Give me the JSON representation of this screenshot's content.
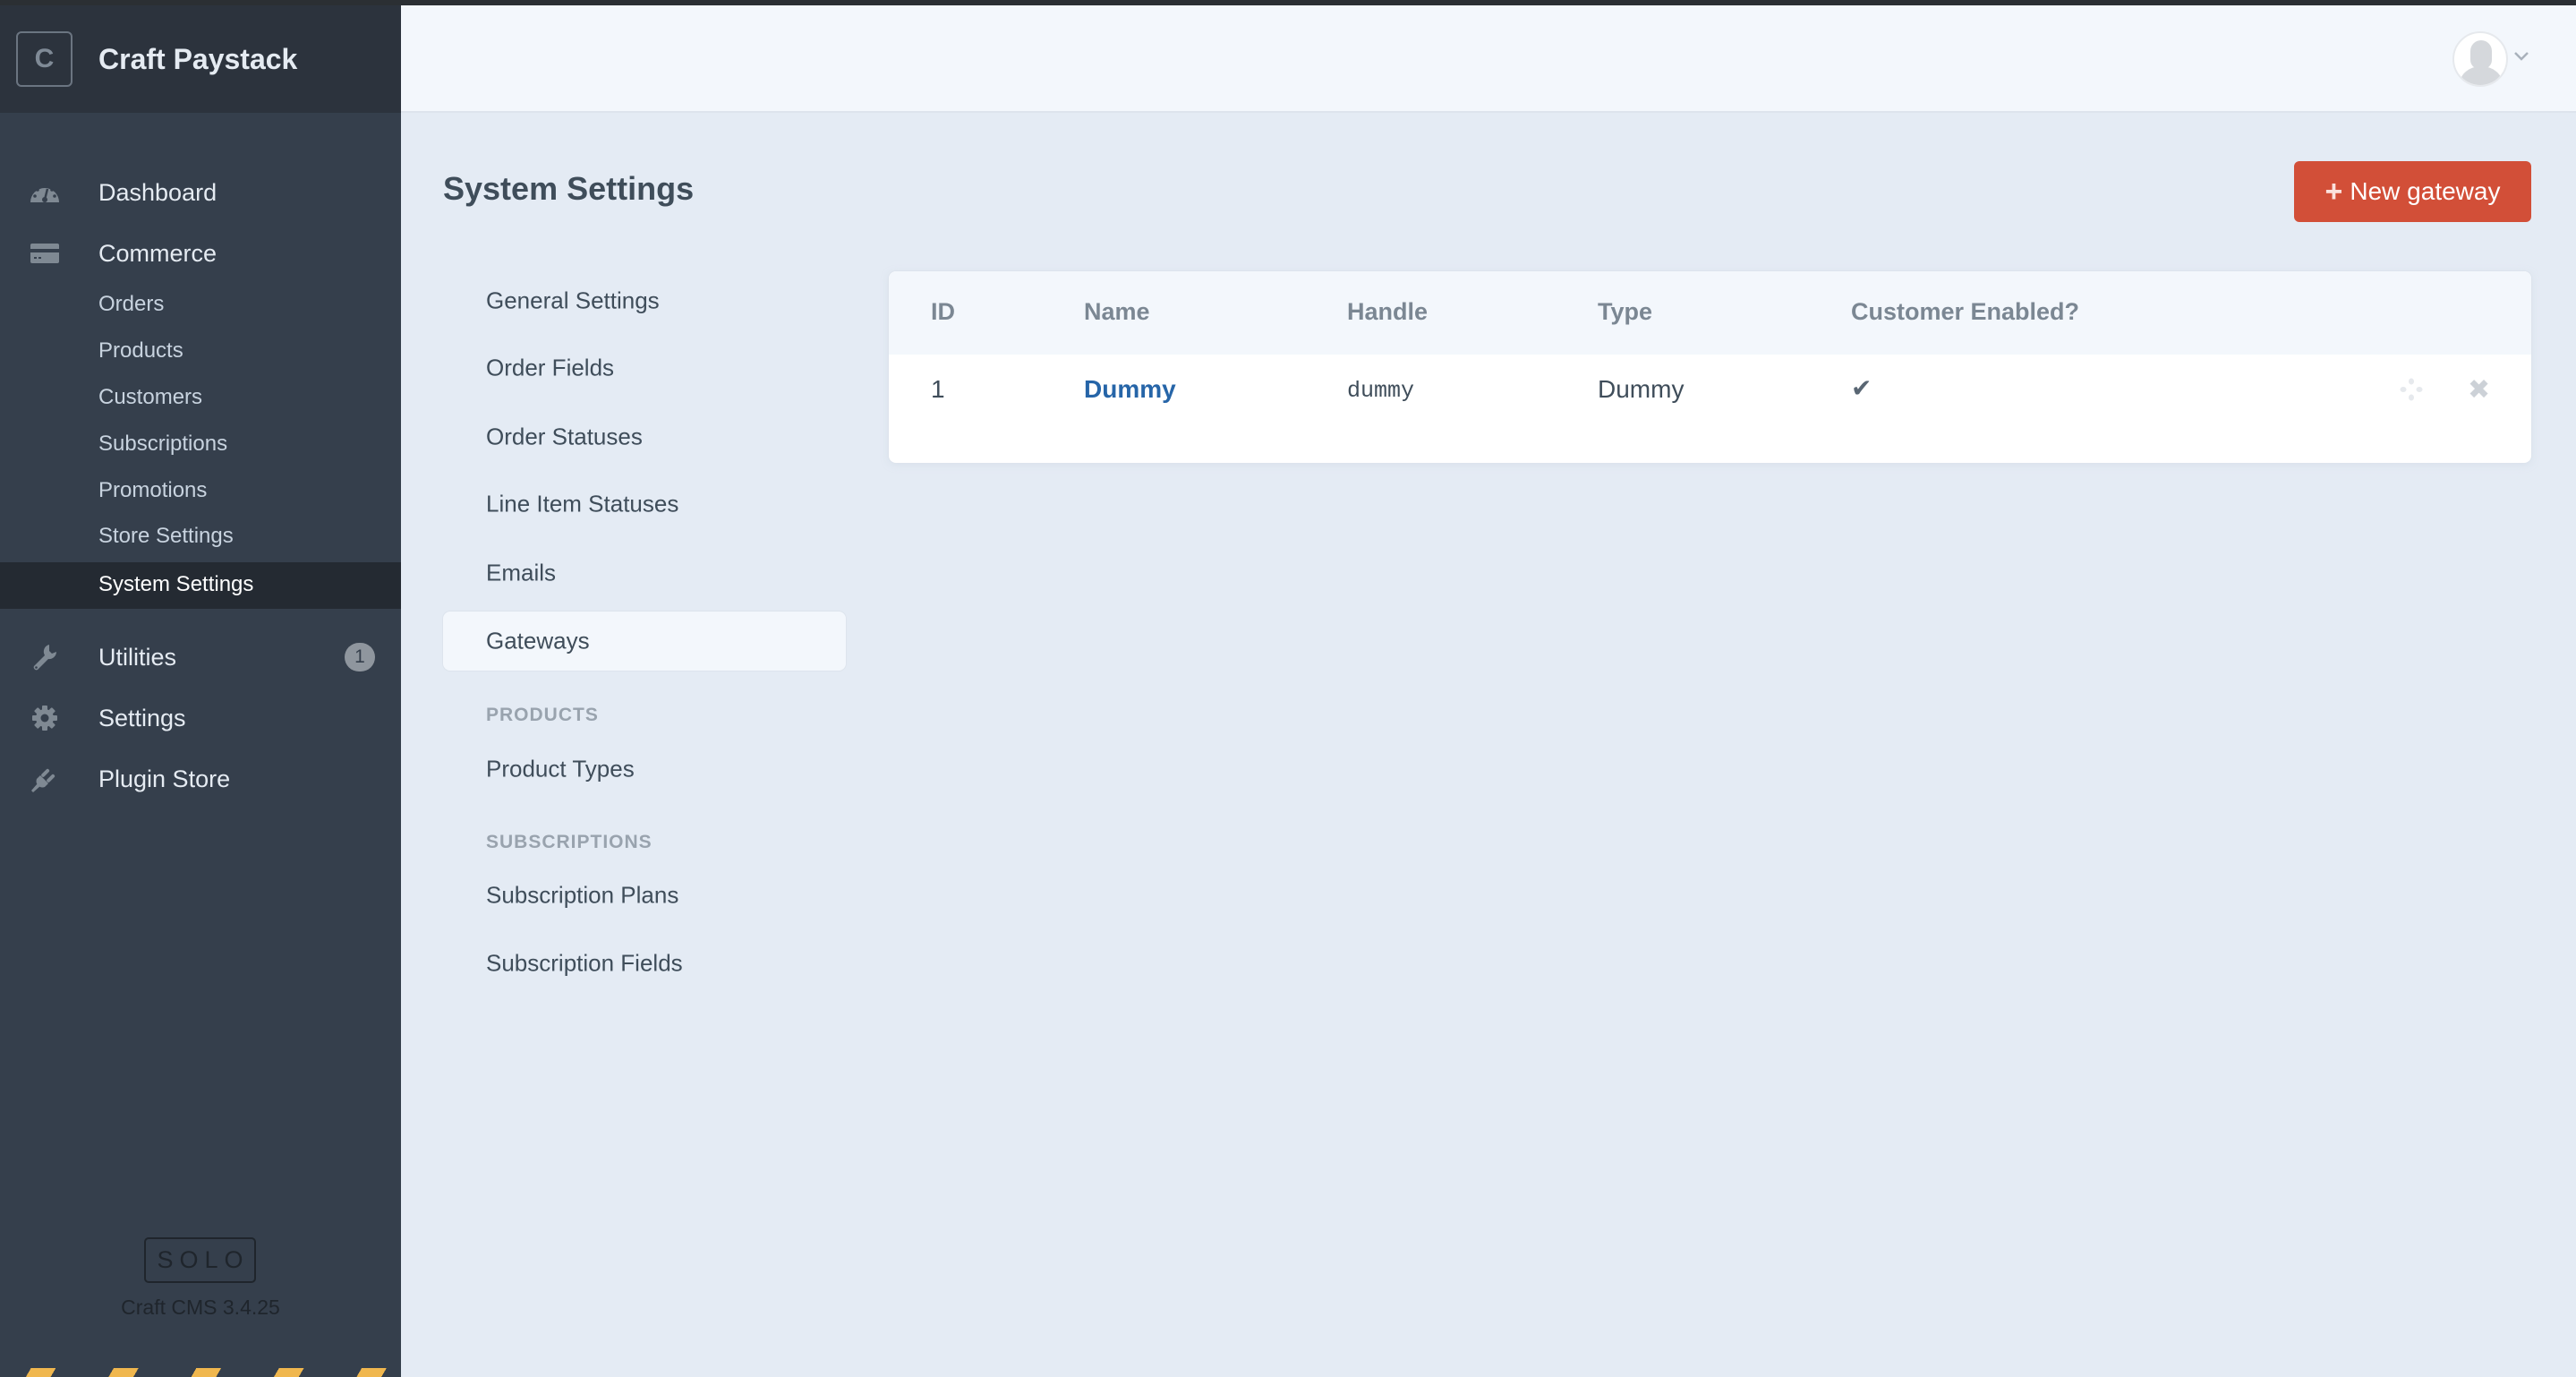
{
  "sidebar": {
    "logo_letter": "C",
    "site_name": "Craft Paystack",
    "nav": [
      {
        "label": "Dashboard",
        "icon": "dashboard-gauge-icon"
      },
      {
        "label": "Commerce",
        "icon": "credit-card-icon"
      },
      {
        "label": "Utilities",
        "icon": "wrench-icon",
        "badge": "1"
      },
      {
        "label": "Settings",
        "icon": "gear-icon"
      },
      {
        "label": "Plugin Store",
        "icon": "plug-icon"
      }
    ],
    "commerce_subnav": [
      {
        "label": "Orders"
      },
      {
        "label": "Products"
      },
      {
        "label": "Customers"
      },
      {
        "label": "Subscriptions"
      },
      {
        "label": "Promotions"
      },
      {
        "label": "Store Settings"
      },
      {
        "label": "System Settings",
        "active": true
      }
    ],
    "edition": "SOLO",
    "version": "Craft CMS 3.4.25"
  },
  "header": {
    "user_menu_icon": "user-avatar-icon"
  },
  "page": {
    "title": "System Settings",
    "new_button": {
      "icon": "+",
      "label": "New gateway",
      "color": "#d24f38"
    }
  },
  "subnav": {
    "items": [
      {
        "label": "General Settings"
      },
      {
        "label": "Order Fields"
      },
      {
        "label": "Order Statuses"
      },
      {
        "label": "Line Item Statuses"
      },
      {
        "label": "Emails"
      },
      {
        "label": "Gateways",
        "active": true
      }
    ],
    "products_heading": "PRODUCTS",
    "products_items": [
      {
        "label": "Product Types"
      }
    ],
    "subscriptions_heading": "SUBSCRIPTIONS",
    "subscriptions_items": [
      {
        "label": "Subscription Plans"
      },
      {
        "label": "Subscription Fields"
      }
    ]
  },
  "table": {
    "columns": [
      "ID",
      "Name",
      "Handle",
      "Type",
      "Customer Enabled?"
    ],
    "rows": [
      {
        "id": "1",
        "name": "Dummy",
        "handle": "dummy",
        "type": "Dummy",
        "customer_enabled": "✔"
      }
    ],
    "link_color": "#2665a8"
  }
}
